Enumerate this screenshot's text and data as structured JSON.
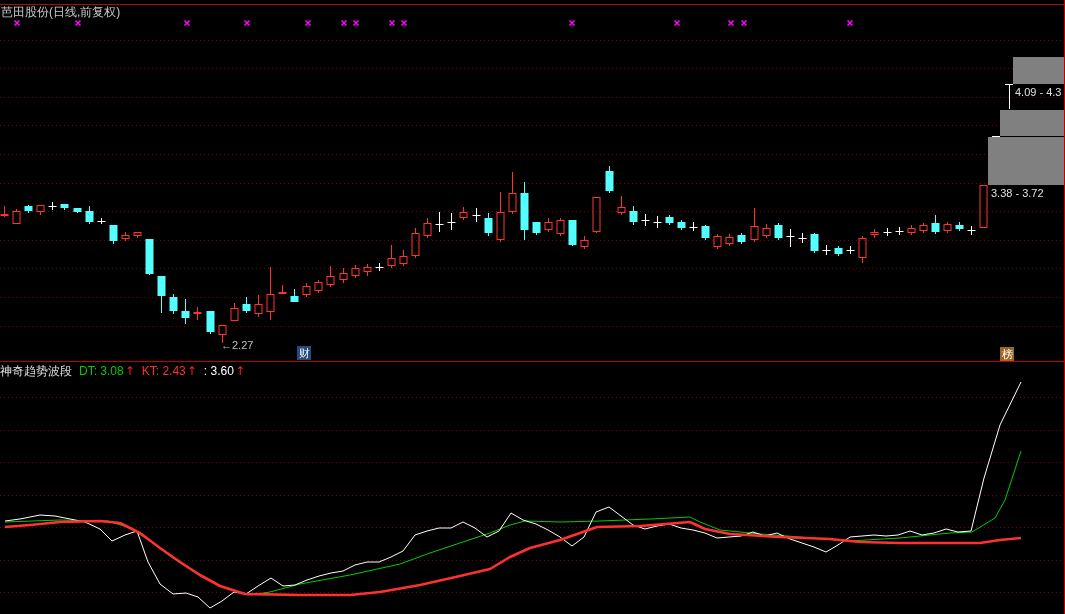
{
  "price_panel": {
    "title": "芭田股份(日线,前复权)",
    "low_marker": "←2.27",
    "badges": [
      {
        "text": "财",
        "kind": "finance"
      },
      {
        "text": "榜",
        "kind": "ranking"
      }
    ],
    "price_ranges": [
      {
        "label": "4.09 - 4.3"
      },
      {
        "label": "3.38 - 3.72"
      }
    ]
  },
  "indicator_panel": {
    "name": "神奇趋势波段",
    "legend": [
      {
        "label": "DT: 3.08",
        "color": "#00cc00",
        "arrow": "↑"
      },
      {
        "label": "KT: 2.43",
        "color": "#ff3030",
        "arrow": "↑"
      },
      {
        "label": ": 3.60",
        "color": "#ffffff",
        "arrow": "↑"
      }
    ]
  }
}
